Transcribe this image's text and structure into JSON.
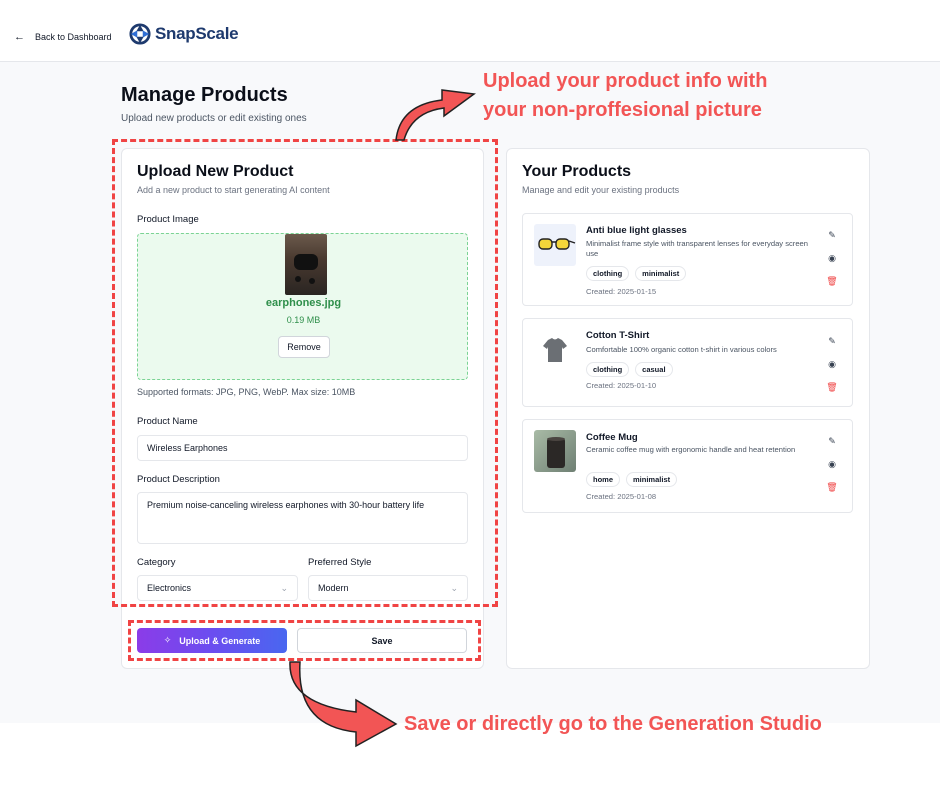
{
  "header": {
    "back_label": "Back to Dashboard",
    "logo_text": "SnapScale"
  },
  "page": {
    "title": "Manage Products",
    "subtitle": "Upload new products or edit existing ones"
  },
  "upload": {
    "title": "Upload New Product",
    "subtitle": "Add a new product to start generating AI content",
    "image_label": "Product Image",
    "file_name": "earphones.jpg",
    "file_size": "0.19 MB",
    "remove_label": "Remove",
    "formats_note": "Supported formats: JPG, PNG, WebP. Max size: 10MB",
    "name_label": "Product Name",
    "name_value": "Wireless Earphones",
    "description_label": "Product Description",
    "description_value": "Premium noise-canceling wireless earphones with 30-hour battery life",
    "category_label": "Category",
    "category_value": "Electronics",
    "style_label": "Preferred Style",
    "style_value": "Modern",
    "generate_label": "Upload & Generate",
    "save_label": "Save"
  },
  "products": {
    "title": "Your Products",
    "subtitle": "Manage and edit your existing products",
    "items": [
      {
        "name": "Anti blue light glasses",
        "description": "Minimalist frame style with transparent lenses for everyday screen use",
        "tags": [
          "clothing",
          "minimalist"
        ],
        "created": "Created: 2025-01-15"
      },
      {
        "name": "Cotton T-Shirt",
        "description": "Comfortable 100% organic cotton t-shirt in various colors",
        "tags": [
          "clothing",
          "casual"
        ],
        "created": "Created: 2025-01-10"
      },
      {
        "name": "Coffee Mug",
        "description": "Ceramic coffee mug with ergonomic handle and heat retention",
        "tags": [
          "home",
          "minimalist"
        ],
        "created": "Created: 2025-01-08"
      }
    ]
  },
  "annotations": {
    "top": "Upload your product info with\nyour non-proffesional picture",
    "bottom": "Save or directly go to the Generation Studio"
  },
  "colors": {
    "accent_start": "#8b3ce8",
    "accent_end": "#4967f0",
    "annotation": "#f25555",
    "success": "#2f8f4b",
    "delete": "#ef4444"
  }
}
